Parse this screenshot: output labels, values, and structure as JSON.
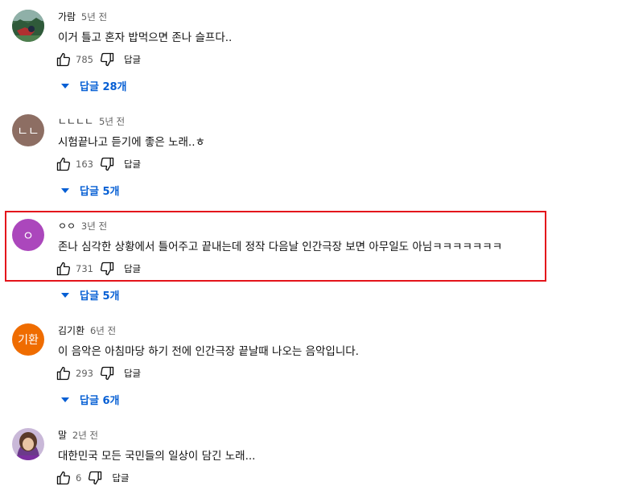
{
  "colors": {
    "link": "#065fd4",
    "highlight_border": "#e4141b",
    "meta": "#606060"
  },
  "comments": [
    {
      "author": "가람",
      "time": "5년 전",
      "text": "이거 틀고 혼자 밥먹으면 존나 슬프다..",
      "likes": "785",
      "reply_label": "답글",
      "replies_label": "답글 28개",
      "avatar": {
        "type": "photo",
        "icon": "landscape-photo-avatar"
      }
    },
    {
      "author": "ㄴㄴㄴㄴ",
      "time": "5년 전",
      "text": "시험끝나고 듣기에 좋은 노래..ㅎ",
      "likes": "163",
      "reply_label": "답글",
      "replies_label": "답글 5개",
      "avatar": {
        "type": "initials",
        "initials": "ㄴㄴ",
        "color": "#8d6e63"
      }
    },
    {
      "author": "ㅇㅇ",
      "time": "3년 전",
      "text": "존나 심각한 상황에서 틀어주고 끝내는데 정작 다음날 인간극장 보면 아무일도 아님ㅋㅋㅋㅋㅋㅋㅋ",
      "likes": "731",
      "reply_label": "답글",
      "replies_label": "답글 5개",
      "avatar": {
        "type": "initials",
        "initials": "ㅇ",
        "color": "#ab47bc"
      },
      "highlighted": true
    },
    {
      "author": "김기환",
      "time": "6년 전",
      "text": "이 음악은 아침마당 하기 전에 인간극장 끝날때 나오는 음악입니다.",
      "likes": "293",
      "reply_label": "답글",
      "replies_label": "답글 6개",
      "avatar": {
        "type": "initials",
        "initials": "기환",
        "color": "#ef6c00"
      }
    },
    {
      "author": "말",
      "time": "2년 전",
      "text": "대한민국 모든 국민들의 일상이 담긴 노래...",
      "likes": "6",
      "reply_label": "답글",
      "avatar": {
        "type": "photo",
        "icon": "person-photo-avatar"
      }
    }
  ]
}
